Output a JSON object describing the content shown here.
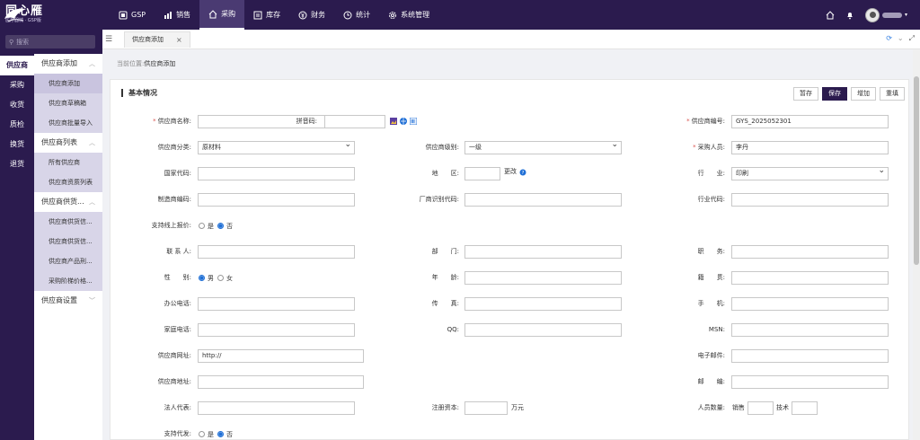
{
  "app": {
    "logo_text": "同心雁",
    "logo_sub": "医疗器械 · GSP版"
  },
  "topnav": [
    {
      "label": "GSP",
      "icon": "gsp-icon"
    },
    {
      "label": "销售",
      "icon": "chart-icon"
    },
    {
      "label": "采购",
      "icon": "home-icon",
      "active": true
    },
    {
      "label": "库存",
      "icon": "inventory-icon"
    },
    {
      "label": "财务",
      "icon": "finance-icon"
    },
    {
      "label": "统计",
      "icon": "clock-icon"
    },
    {
      "label": "系统管理",
      "icon": "gear-icon"
    }
  ],
  "search": {
    "placeholder": "搜索"
  },
  "modules": [
    "供应商",
    "采购",
    "收货",
    "质检",
    "换货",
    "退货"
  ],
  "menu": {
    "g1": "供应商添加",
    "g1_items": [
      "供应商添加",
      "供应商草稿箱",
      "供应商批量导入"
    ],
    "g2": "供应商列表",
    "g2_items": [
      "所有供应商",
      "供应商资质列表"
    ],
    "g3": "供应商供货...",
    "g3_items": [
      "供应商供货信...",
      "供应商供货信...",
      "供应商产品刑...",
      "采购阶梯价格..."
    ],
    "g4": "供应商设置"
  },
  "tab": {
    "label": "供应商添加"
  },
  "breadcrumb": {
    "prefix": "当前位置:",
    "current": "供应商添加"
  },
  "panel": {
    "title": "基本情况",
    "buttons": [
      "暂存",
      "保存",
      "增加",
      "重填"
    ]
  },
  "form": {
    "supplier_name": {
      "label": "供应商名称:",
      "value": ""
    },
    "pinyin": {
      "label": "拼音码:",
      "value": ""
    },
    "supplier_code": {
      "label": "供应商编号:",
      "value": "GYS_2025052301"
    },
    "category": {
      "label": "供应商分类:",
      "value": "原材料"
    },
    "level": {
      "label": "供应商级别:",
      "value": "一级"
    },
    "buyer": {
      "label": "采购人员:",
      "value": "李丹"
    },
    "country_code": {
      "label": "国家代码:",
      "value": ""
    },
    "region": {
      "label": "地　　区:",
      "value": "",
      "change": "更改"
    },
    "industry": {
      "label": "行　　业:",
      "value": "印刷"
    },
    "manufacturer_code": {
      "label": "制造商编码:",
      "value": ""
    },
    "vendor_id_code": {
      "label": "厂商识别代码:",
      "value": ""
    },
    "industry_code": {
      "label": "行业代码:",
      "value": ""
    },
    "online_quote": {
      "label": "支持线上报价:",
      "yes": "是",
      "no": "否"
    },
    "contact": {
      "label": "联 系 人:",
      "value": ""
    },
    "department": {
      "label": "部　　门:",
      "value": ""
    },
    "position": {
      "label": "职　　务:",
      "value": ""
    },
    "gender": {
      "label": "性　　别:",
      "male": "男",
      "female": "女"
    },
    "age": {
      "label": "年　　龄:",
      "value": ""
    },
    "origin": {
      "label": "籍　　贯:",
      "value": ""
    },
    "office_phone": {
      "label": "办公电话:",
      "value": ""
    },
    "fax": {
      "label": "传　　真:",
      "value": ""
    },
    "mobile": {
      "label": "手　　机:",
      "value": ""
    },
    "home_phone": {
      "label": "家庭电话:",
      "value": ""
    },
    "qq": {
      "label": "QQ:",
      "value": ""
    },
    "msn": {
      "label": "MSN:",
      "value": ""
    },
    "website": {
      "label": "供应商网址:",
      "value": "http://"
    },
    "email": {
      "label": "电子邮件:",
      "value": ""
    },
    "address": {
      "label": "供应商地址:",
      "value": ""
    },
    "postcode": {
      "label": "邮　　编:",
      "value": ""
    },
    "legal_rep": {
      "label": "法人代表:",
      "value": ""
    },
    "capital": {
      "label": "注册资本:",
      "value": "",
      "unit": "万元"
    },
    "staff": {
      "label": "人员数量:",
      "sales": "销售",
      "tech": "技术"
    },
    "agent": {
      "label": "支持代发:",
      "yes": "是",
      "no": "否"
    }
  },
  "colors": {
    "brand": "#2b1b4e",
    "link": "#1f6fd6"
  }
}
